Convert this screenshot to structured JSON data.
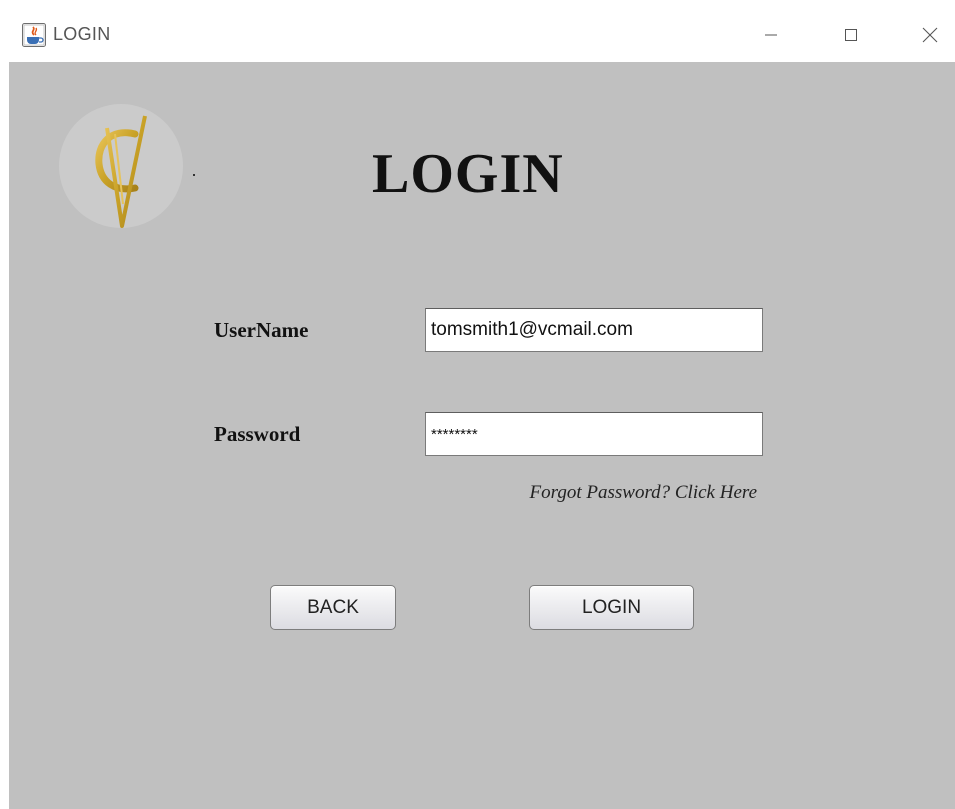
{
  "window": {
    "title": "LOGIN",
    "controls": {
      "minimize": "minimize-icon",
      "maximize": "maximize-icon",
      "close": "close-icon"
    }
  },
  "header": {
    "title": "LOGIN",
    "logo_icon": "vc-logo-icon"
  },
  "form": {
    "username_label": "UserName",
    "username_value": "tomsmith1@vcmail.com",
    "password_label": "Password",
    "password_value": "********",
    "forgot_link": "Forgot Password? Click Here"
  },
  "buttons": {
    "back_label": "BACK",
    "login_label": "LOGIN"
  },
  "colors": {
    "background": "#c0c0c0",
    "logo_gold": "#c9a227",
    "text": "#111111"
  }
}
